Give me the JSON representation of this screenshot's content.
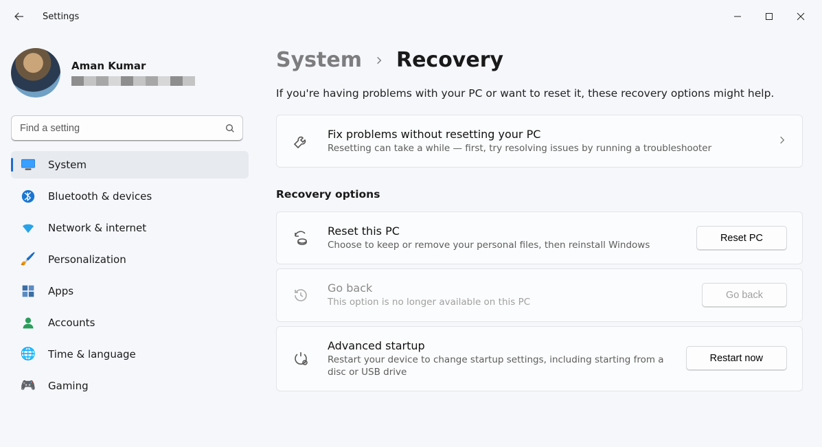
{
  "app": {
    "title": "Settings"
  },
  "profile": {
    "name": "Aman Kumar"
  },
  "search": {
    "placeholder": "Find a setting"
  },
  "sidebar": {
    "items": [
      {
        "label": "System",
        "icon": "monitor",
        "active": true
      },
      {
        "label": "Bluetooth & devices",
        "icon": "bluetooth"
      },
      {
        "label": "Network & internet",
        "icon": "wifi"
      },
      {
        "label": "Personalization",
        "icon": "brush"
      },
      {
        "label": "Apps",
        "icon": "apps"
      },
      {
        "label": "Accounts",
        "icon": "person"
      },
      {
        "label": "Time & language",
        "icon": "globe-clock"
      },
      {
        "label": "Gaming",
        "icon": "gamepad"
      }
    ]
  },
  "breadcrumb": {
    "root": "System",
    "current": "Recovery"
  },
  "intro": "If you're having problems with your PC or want to reset it, these recovery options might help.",
  "fixCard": {
    "title": "Fix problems without resetting your PC",
    "sub": "Resetting can take a while — first, try resolving issues by running a troubleshooter"
  },
  "sectionTitle": "Recovery options",
  "resetCard": {
    "title": "Reset this PC",
    "sub": "Choose to keep or remove your personal files, then reinstall Windows",
    "button": "Reset PC"
  },
  "goBackCard": {
    "title": "Go back",
    "sub": "This option is no longer available on this PC",
    "button": "Go back"
  },
  "advancedCard": {
    "title": "Advanced startup",
    "sub": "Restart your device to change startup settings, including starting from a disc or USB drive",
    "button": "Restart now"
  }
}
